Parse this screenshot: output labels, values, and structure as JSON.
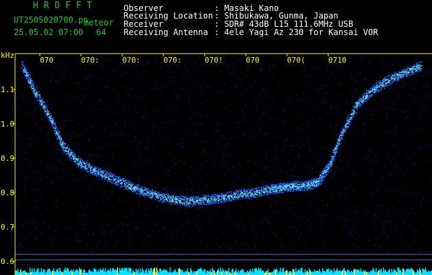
{
  "header": {
    "app_name": "H R O F F T",
    "file_name": "UT2505020700.pn",
    "mode": "meteor",
    "datetime": "25.05.02 07:00",
    "count": "64",
    "observer_label": "Observer",
    "observer_value": ": Masaki Kano",
    "location_label": "Receiving Location",
    "location_value": ": Shibukawa, Gunma, Japan",
    "receiver_label": "Receiver",
    "receiver_value": ": SDR# 43dB L15 111.6MHz USB",
    "antenna_label": "Receiving Antenna",
    "antenna_value": ": 4ele Yagi Az 230 for Kansai VOR"
  },
  "colors": {
    "background": "#000000",
    "header_green": "#22cc22",
    "header_white": "#ffffff",
    "axis_yellow": "#ffff00",
    "noise_blue": "#0a0a8c",
    "trace_cyan": "#33ccff",
    "bottom_cyan": "#00e5ff"
  },
  "chart_data": {
    "type": "heatmap",
    "ylabel": "kHz",
    "y_ticks": [
      "1.1",
      "1.0",
      "0.9",
      "0.8",
      "0.7",
      "0.6"
    ],
    "y_tick_values": [
      1.1,
      1.0,
      0.9,
      0.8,
      0.7,
      0.6
    ],
    "x_ticks": [
      "070",
      "070:",
      "070:",
      "070:",
      "070!",
      "070",
      "070(",
      "0710"
    ],
    "x_tick_minutes": [
      0,
      1,
      2,
      3,
      4,
      5,
      6,
      7
    ],
    "y_range": [
      0.6,
      1.18
    ],
    "x_range_minutes": [
      0,
      10
    ],
    "trace": {
      "x": [
        0.0,
        0.3,
        0.7,
        1.0,
        1.4,
        1.8,
        2.2,
        2.6,
        3.0,
        3.4,
        3.8,
        4.2,
        4.6,
        5.0,
        5.4,
        5.8,
        6.2,
        6.5,
        6.8,
        7.1,
        7.4,
        7.7,
        8.0,
        8.4,
        8.8,
        9.2,
        9.6,
        10.0
      ],
      "y": [
        1.17,
        1.1,
        1.02,
        0.94,
        0.89,
        0.865,
        0.845,
        0.825,
        0.805,
        0.79,
        0.78,
        0.775,
        0.78,
        0.785,
        0.795,
        0.8,
        0.81,
        0.815,
        0.82,
        0.82,
        0.83,
        0.88,
        0.97,
        1.06,
        1.1,
        1.13,
        1.15,
        1.17
      ]
    }
  }
}
